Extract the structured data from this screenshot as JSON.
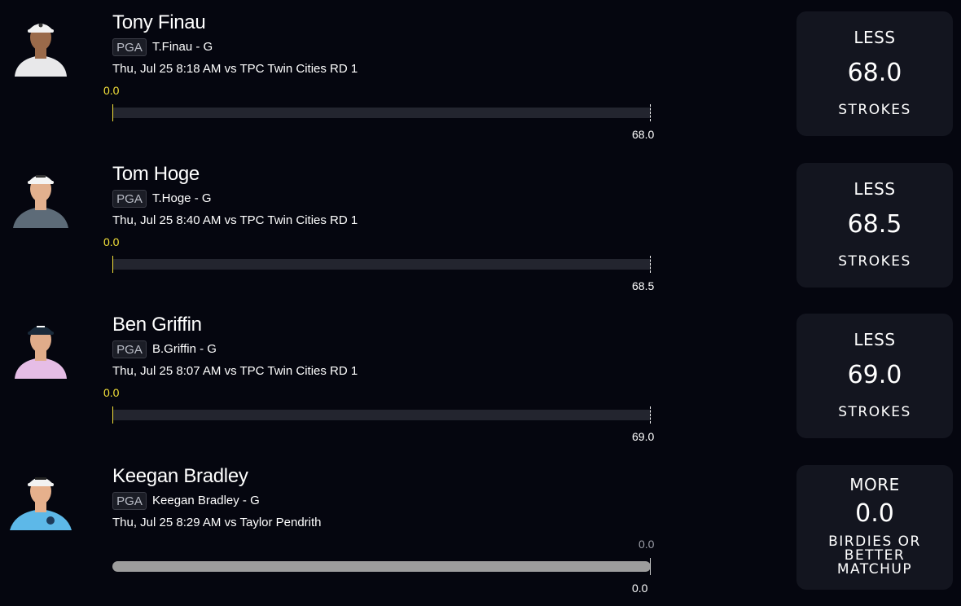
{
  "players": [
    {
      "name": "Tony Finau",
      "league": "PGA",
      "short_name": "T.Finau - G",
      "game_info": "Thu, Jul 25 8:18 AM  vs TPC Twin Cities RD 1",
      "current_value": "0.0",
      "line_value": "68.0",
      "progress": 0,
      "pick": {
        "direction": "LESS",
        "value": "68.0",
        "stat": "STROKES"
      },
      "avatar": {
        "shirt": "#e8e8ea",
        "skin": "#9a6a4a",
        "hat": "#f2f2f2"
      }
    },
    {
      "name": "Tom Hoge",
      "league": "PGA",
      "short_name": "T.Hoge - G",
      "game_info": "Thu, Jul 25 8:40 AM  vs TPC Twin Cities RD 1",
      "current_value": "0.0",
      "line_value": "68.5",
      "progress": 0,
      "pick": {
        "direction": "LESS",
        "value": "68.5",
        "stat": "STROKES"
      },
      "avatar": {
        "shirt": "#5d6b78",
        "skin": "#e2b08e",
        "hat": "#f4f4f4"
      }
    },
    {
      "name": "Ben Griffin",
      "league": "PGA",
      "short_name": "B.Griffin - G",
      "game_info": "Thu, Jul 25 8:07 AM  vs TPC Twin Cities RD 1",
      "current_value": "0.0",
      "line_value": "69.0",
      "progress": 0,
      "pick": {
        "direction": "LESS",
        "value": "69.0",
        "stat": "STROKES"
      },
      "avatar": {
        "shirt": "#e6bde6",
        "skin": "#e0ac8a",
        "hat": "#1a2a3a"
      }
    },
    {
      "name": "Keegan Bradley",
      "league": "PGA",
      "short_name": "Keegan Bradley - G",
      "game_info": "Thu, Jul 25 8:29 AM  vs Taylor Pendrith",
      "current_value": "0.0",
      "line_value": "0.0",
      "progress": 1,
      "pick": {
        "direction": "MORE",
        "value": "0.0",
        "stat": "BIRDIES OR BETTER MATCHUP"
      },
      "avatar": {
        "shirt": "#5db8e8",
        "skin": "#e6b08c",
        "hat": "#f2f2f2"
      }
    }
  ]
}
